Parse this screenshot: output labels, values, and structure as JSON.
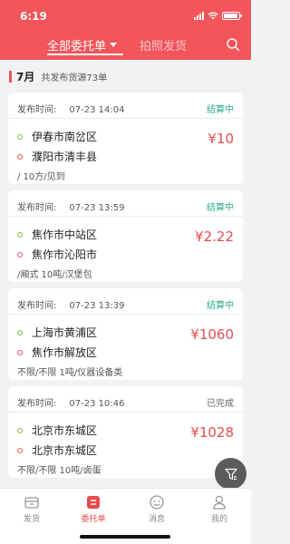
{
  "status_bar": {
    "time": "6:19"
  },
  "nav": {
    "active_tab": "全部委托单",
    "inactive_tab": "拍照发货"
  },
  "summary": {
    "month": "7月",
    "total": "共发布货源73单"
  },
  "labels": {
    "publish_time": "发布时间:"
  },
  "cards": [
    {
      "time": "07-23 14:04",
      "status": "结算中",
      "status_color": "#2aaa8a",
      "from": "伊春市南岔区",
      "to": "濮阳市清丰县",
      "price": "¥10",
      "detail": "/ 10方/见到"
    },
    {
      "time": "07-23 13:59",
      "status": "结算中",
      "status_color": "#2aaa8a",
      "from": "焦作市中站区",
      "to": "焦作市沁阳市",
      "price": "¥2.22",
      "detail": "/厢式 10吨/汉堡包"
    },
    {
      "time": "07-23 13:39",
      "status": "结算中",
      "status_color": "#2aaa8a",
      "from": "上海市黄浦区",
      "to": "焦作市解放区",
      "price": "¥1060",
      "detail": "不限/不限 1吨/仪器设备类"
    },
    {
      "time": "07-23 10:46",
      "status": "已完成",
      "status_color": "#666666",
      "from": "北京市东城区",
      "to": "北京市东城区",
      "price": "¥1028",
      "detail": "不限/不限 10吨/卤蛋"
    }
  ],
  "tabbar": [
    {
      "label": "发货",
      "icon": "ship-icon"
    },
    {
      "label": "委托单",
      "icon": "order-icon"
    },
    {
      "label": "消息",
      "icon": "message-icon"
    },
    {
      "label": "我的",
      "icon": "profile-icon"
    }
  ],
  "colors": {
    "brand": "#f2555a",
    "price": "#e94b4e",
    "settling": "#2aaa8a"
  }
}
